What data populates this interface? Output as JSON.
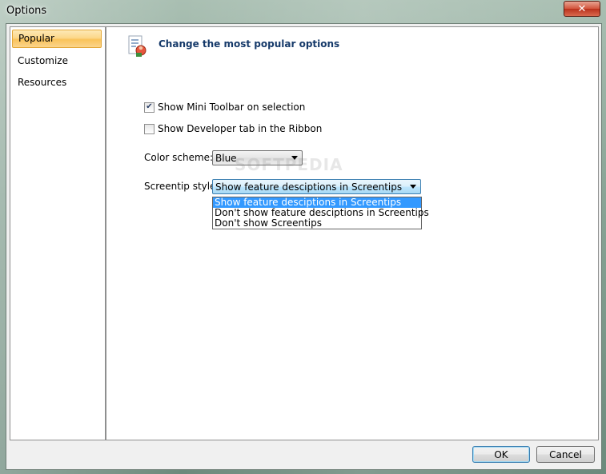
{
  "window": {
    "title": "Options",
    "close_glyph": "✕"
  },
  "nav": {
    "items": [
      {
        "label": "Popular",
        "selected": true
      },
      {
        "label": "Customize",
        "selected": false
      },
      {
        "label": "Resources",
        "selected": false
      }
    ]
  },
  "content": {
    "header_title": "Change the most popular options",
    "header_icon": "options-icon",
    "show_mini_toolbar": {
      "label": "Show Mini Toolbar on selection",
      "checked": true
    },
    "show_developer_tab": {
      "label": "Show Developer tab in the Ribbon",
      "checked": false
    },
    "color_scheme": {
      "label": "Color scheme:",
      "value": "Blue"
    },
    "screentip_style": {
      "label": "Screentip style:",
      "value": "Show feature desciptions in Screentips",
      "options": [
        "Show feature desciptions in Screentips",
        "Don't show feature desciptions in Screentips",
        "Don't show Screentips"
      ],
      "selected_index": 0
    },
    "watermark": "SOFTPEDIA"
  },
  "buttons": {
    "ok": "OK",
    "cancel": "Cancel"
  },
  "colors": {
    "selection": "#3399ff",
    "nav_selected": "#f9c35a",
    "header_text": "#163a6a"
  }
}
